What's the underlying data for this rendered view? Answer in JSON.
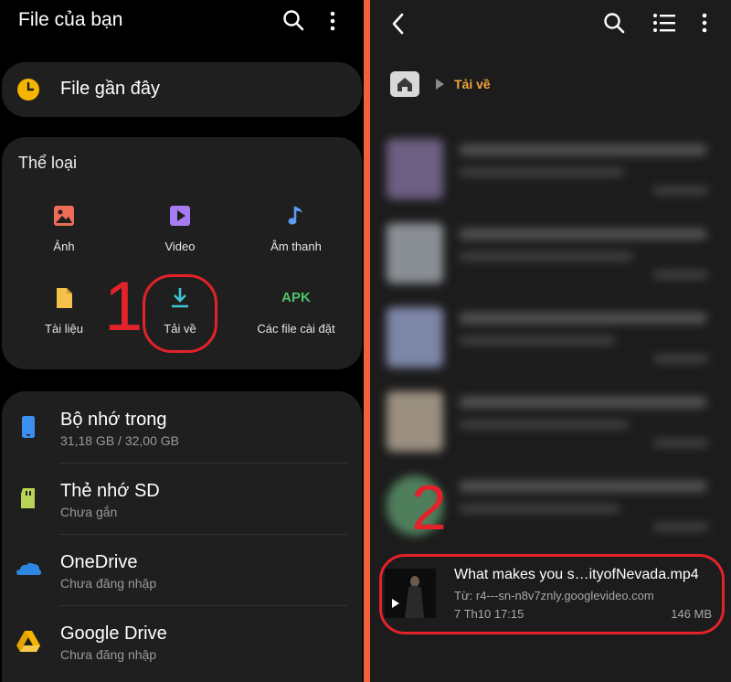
{
  "left": {
    "header": {
      "title": "File của bạn",
      "search_icon": "search-icon",
      "more_icon": "more-vertical-icon"
    },
    "recent": {
      "label": "File gần đây",
      "icon": "clock-icon",
      "icon_color": "#f4b400"
    },
    "categories": {
      "title": "Thể loại",
      "items": [
        {
          "label": "Ảnh",
          "icon": "image-icon",
          "color": "#ef6c57"
        },
        {
          "label": "Video",
          "icon": "video-icon",
          "color": "#a77bf3"
        },
        {
          "label": "Âm thanh",
          "icon": "music-note-icon",
          "color": "#5b9cf5"
        },
        {
          "label": "Tài liệu",
          "icon": "document-icon",
          "color": "#f6c14a"
        },
        {
          "label": "Tải về",
          "icon": "download-icon",
          "color": "#3ec4d6"
        },
        {
          "label": "Các file cài đặt",
          "icon": "apk-icon",
          "icon_text": "APK",
          "color": "#4fc36a"
        }
      ]
    },
    "storage": [
      {
        "name": "Bộ nhớ trong",
        "sub": "31,18 GB / 32,00 GB",
        "icon": "phone-icon",
        "color": "#3b8ff0"
      },
      {
        "name": "Thẻ nhớ SD",
        "sub": "Chưa gắn",
        "icon": "sd-card-icon",
        "color": "#b9d354"
      },
      {
        "name": "OneDrive",
        "sub": "Chưa đăng nhập",
        "icon": "onedrive-icon",
        "color": "#2f86e0"
      },
      {
        "name": "Google Drive",
        "sub": "Chưa đăng nhập",
        "icon": "google-drive-icon",
        "color": "#f4b400"
      }
    ],
    "annotation": "1"
  },
  "right": {
    "breadcrumb": {
      "current": "Tải về",
      "home_icon": "home-icon"
    },
    "file": {
      "name": "What makes you s…ityofNevada.mp4",
      "source": "Từ: r4---sn-n8v7znly.googlevideo.com",
      "date": "7 Th10 17:15",
      "size": "146 MB"
    },
    "annotation": "2"
  },
  "colors": {
    "accent": "#f0a63a",
    "annotation": "#e3222a",
    "separator": "#f0623b"
  }
}
